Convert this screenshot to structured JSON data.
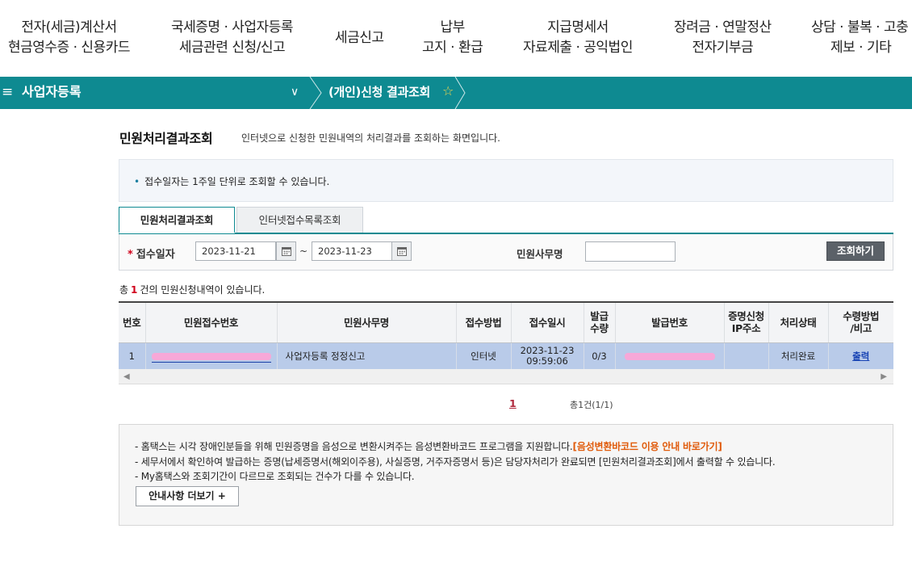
{
  "topmenu": [
    {
      "line1": "전자(세금)계산서",
      "line2": "현금영수증 · 신용카드"
    },
    {
      "line1": "국세증명 · 사업자등록",
      "line2": "세금관련 신청/신고"
    },
    {
      "line1": "세금신고",
      "line2": ""
    },
    {
      "line1": "납부",
      "line2": "고지 · 환급"
    },
    {
      "line1": "지급명세서",
      "line2": "자료제출 · 공익법인"
    },
    {
      "line1": "장려금 · 연말정산",
      "line2": "전자기부금"
    },
    {
      "line1": "상담 · 불복 · 고충",
      "line2": "제보 · 기타"
    }
  ],
  "breadcrumb": {
    "menu_icon": "≡",
    "section": "사업자등록",
    "chevron": "∨",
    "page": "(개인)신청 결과조회",
    "star": "☆"
  },
  "page": {
    "title": "민원처리결과조회",
    "desc": "인터넷으로 신청한 민원내역의 처리결과를 조회하는 화면입니다.",
    "notice_bullet": "•",
    "notice": "접수일자는 1주일 단위로 조회할 수 있습니다."
  },
  "tabs": [
    {
      "label": "민원처리결과조회",
      "active": true
    },
    {
      "label": "인터넷접수목록조회",
      "active": false
    }
  ],
  "search": {
    "req_mark": "*",
    "date_label": "접수일자",
    "date_from": "2023-11-21",
    "date_to": "2023-11-23",
    "tilde": "~",
    "office_label": "민원사무명",
    "office_value": "",
    "submit": "조회하기"
  },
  "count": {
    "prefix": "총",
    "num": "1",
    "suffix": "건의 민원신청내역이 있습니다."
  },
  "table": {
    "headers": [
      {
        "l1": "번호",
        "l2": ""
      },
      {
        "l1": "민원접수번호",
        "l2": ""
      },
      {
        "l1": "민원사무명",
        "l2": ""
      },
      {
        "l1": "접수방법",
        "l2": ""
      },
      {
        "l1": "접수일시",
        "l2": ""
      },
      {
        "l1": "발급",
        "l2": "수량"
      },
      {
        "l1": "발급번호",
        "l2": ""
      },
      {
        "l1": "증명신청",
        "l2": "IP주소"
      },
      {
        "l1": "처리상태",
        "l2": ""
      },
      {
        "l1": "수령방법",
        "l2": "/비고"
      }
    ],
    "rows": [
      {
        "no": "1",
        "receipt_no": "",
        "office": "사업자등록 정정신고",
        "method": "인터넷",
        "date": "2023-11-23",
        "time": "09:59:06",
        "qty": "0/3",
        "issue_no": "",
        "ip": "",
        "status": "처리완료",
        "action": "출력"
      }
    ]
  },
  "scroll": {
    "left": "◀",
    "right": "▶"
  },
  "pagination": {
    "current": "1",
    "total": "총1건(1/1)"
  },
  "guide": {
    "line1_text": "- 홈택스는 시각 장애인분들을 위해 민원증명을 음성으로 변환시켜주는 음성변환바코드 프로그램을 지원합니다.",
    "line1_link": "[음성변환바코드 이용 안내 바로가기]",
    "line2": "- 세무서에서 확인하여 발급하는 증명(납세증명서(해외이주용), 사실증명, 거주자증명서 등)은 담당자처리가 완료되면 [민원처리결과조회]에서 출력할 수 있습니다.",
    "line3": "- My홈택스와 조회기간이 다르므로 조회되는 건수가 다를 수 있습니다.",
    "more_button": "안내사항 더보기 +"
  },
  "colors": {
    "accent": "#0e8a91",
    "selected_row": "#b9cbe9",
    "required": "#d0021b",
    "highlight_link": "#e05a0a",
    "redaction": "#f7a8d8"
  }
}
